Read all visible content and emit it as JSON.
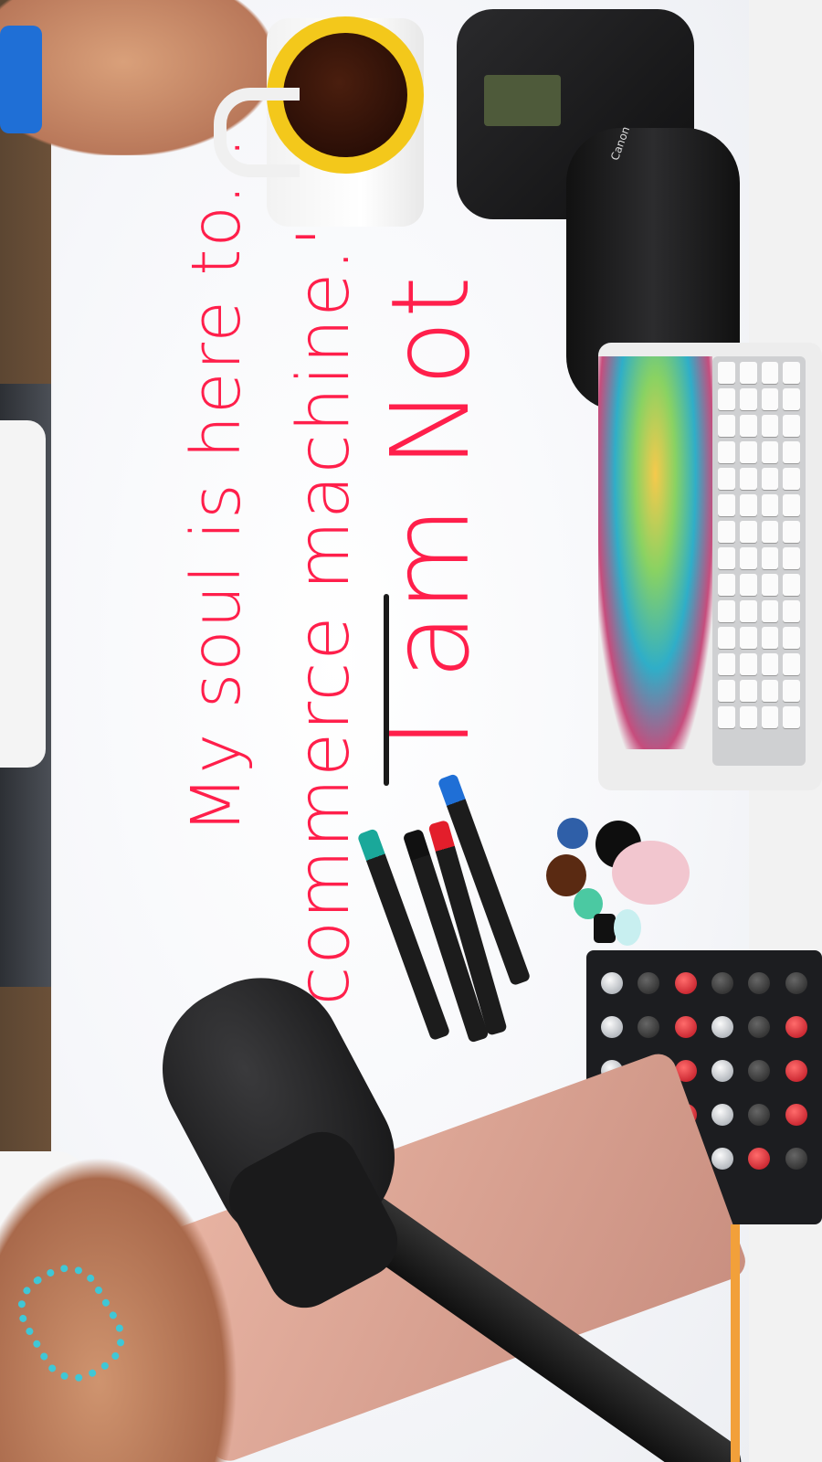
{
  "photo": {
    "handwriting": {
      "line1": "I am Not",
      "line2": "a \"commerce machine.\"",
      "line3": "My soul is here to..."
    },
    "objects": {
      "camera_brand": "Canon",
      "icons": [
        "coffee-mug-icon",
        "camera-icon",
        "keyboard-icon",
        "marker-icon",
        "microphone-icon",
        "mixer-icon",
        "laptop-icon"
      ]
    },
    "colors": {
      "ink_red": "#ff1f4b",
      "ink_black": "#1a1a1a",
      "mug_yellow": "#f3c81b",
      "board_white": "#f6f7fa"
    }
  }
}
